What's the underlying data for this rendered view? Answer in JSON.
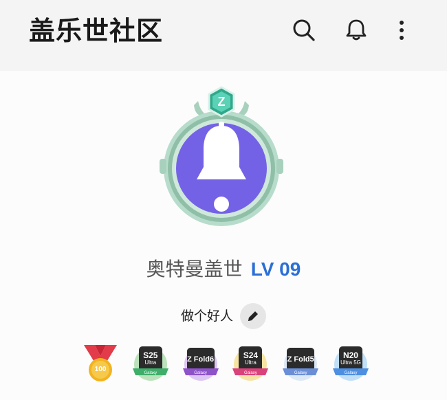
{
  "header": {
    "title": "盖乐世社区",
    "icons": [
      "search-icon",
      "bell-icon",
      "more-vertical-icon"
    ]
  },
  "profile": {
    "avatar_icon": "bell-icon",
    "emblem_letter": "Z",
    "nickname": "奥特曼盖世",
    "level": "LV 09",
    "bio": "做个好人",
    "edit_icon": "pencil-icon"
  },
  "badges": [
    {
      "type": "medal",
      "label": "100",
      "color": "#f2b320"
    },
    {
      "type": "device",
      "main": "S25",
      "sub": "Ultra",
      "ribbon": "Galaxy",
      "color": "#3fae6a"
    },
    {
      "type": "device",
      "main": "Z Fold6",
      "sub": "",
      "ribbon": "Galaxy",
      "color": "#8e52c9"
    },
    {
      "type": "device",
      "main": "S24",
      "sub": "Ultra",
      "ribbon": "Galaxy",
      "color": "#d9427b"
    },
    {
      "type": "device",
      "main": "Z Fold5",
      "sub": "",
      "ribbon": "Galaxy",
      "color": "#6b8fd6"
    },
    {
      "type": "device",
      "main": "N20",
      "sub": "Ultra 5G",
      "ribbon": "Galaxy",
      "color": "#4d8fe0"
    }
  ],
  "colors": {
    "level_accent": "#2b6fd6",
    "avatar_inner": "#7462e6",
    "avatar_frame": "#9fc9b4"
  }
}
